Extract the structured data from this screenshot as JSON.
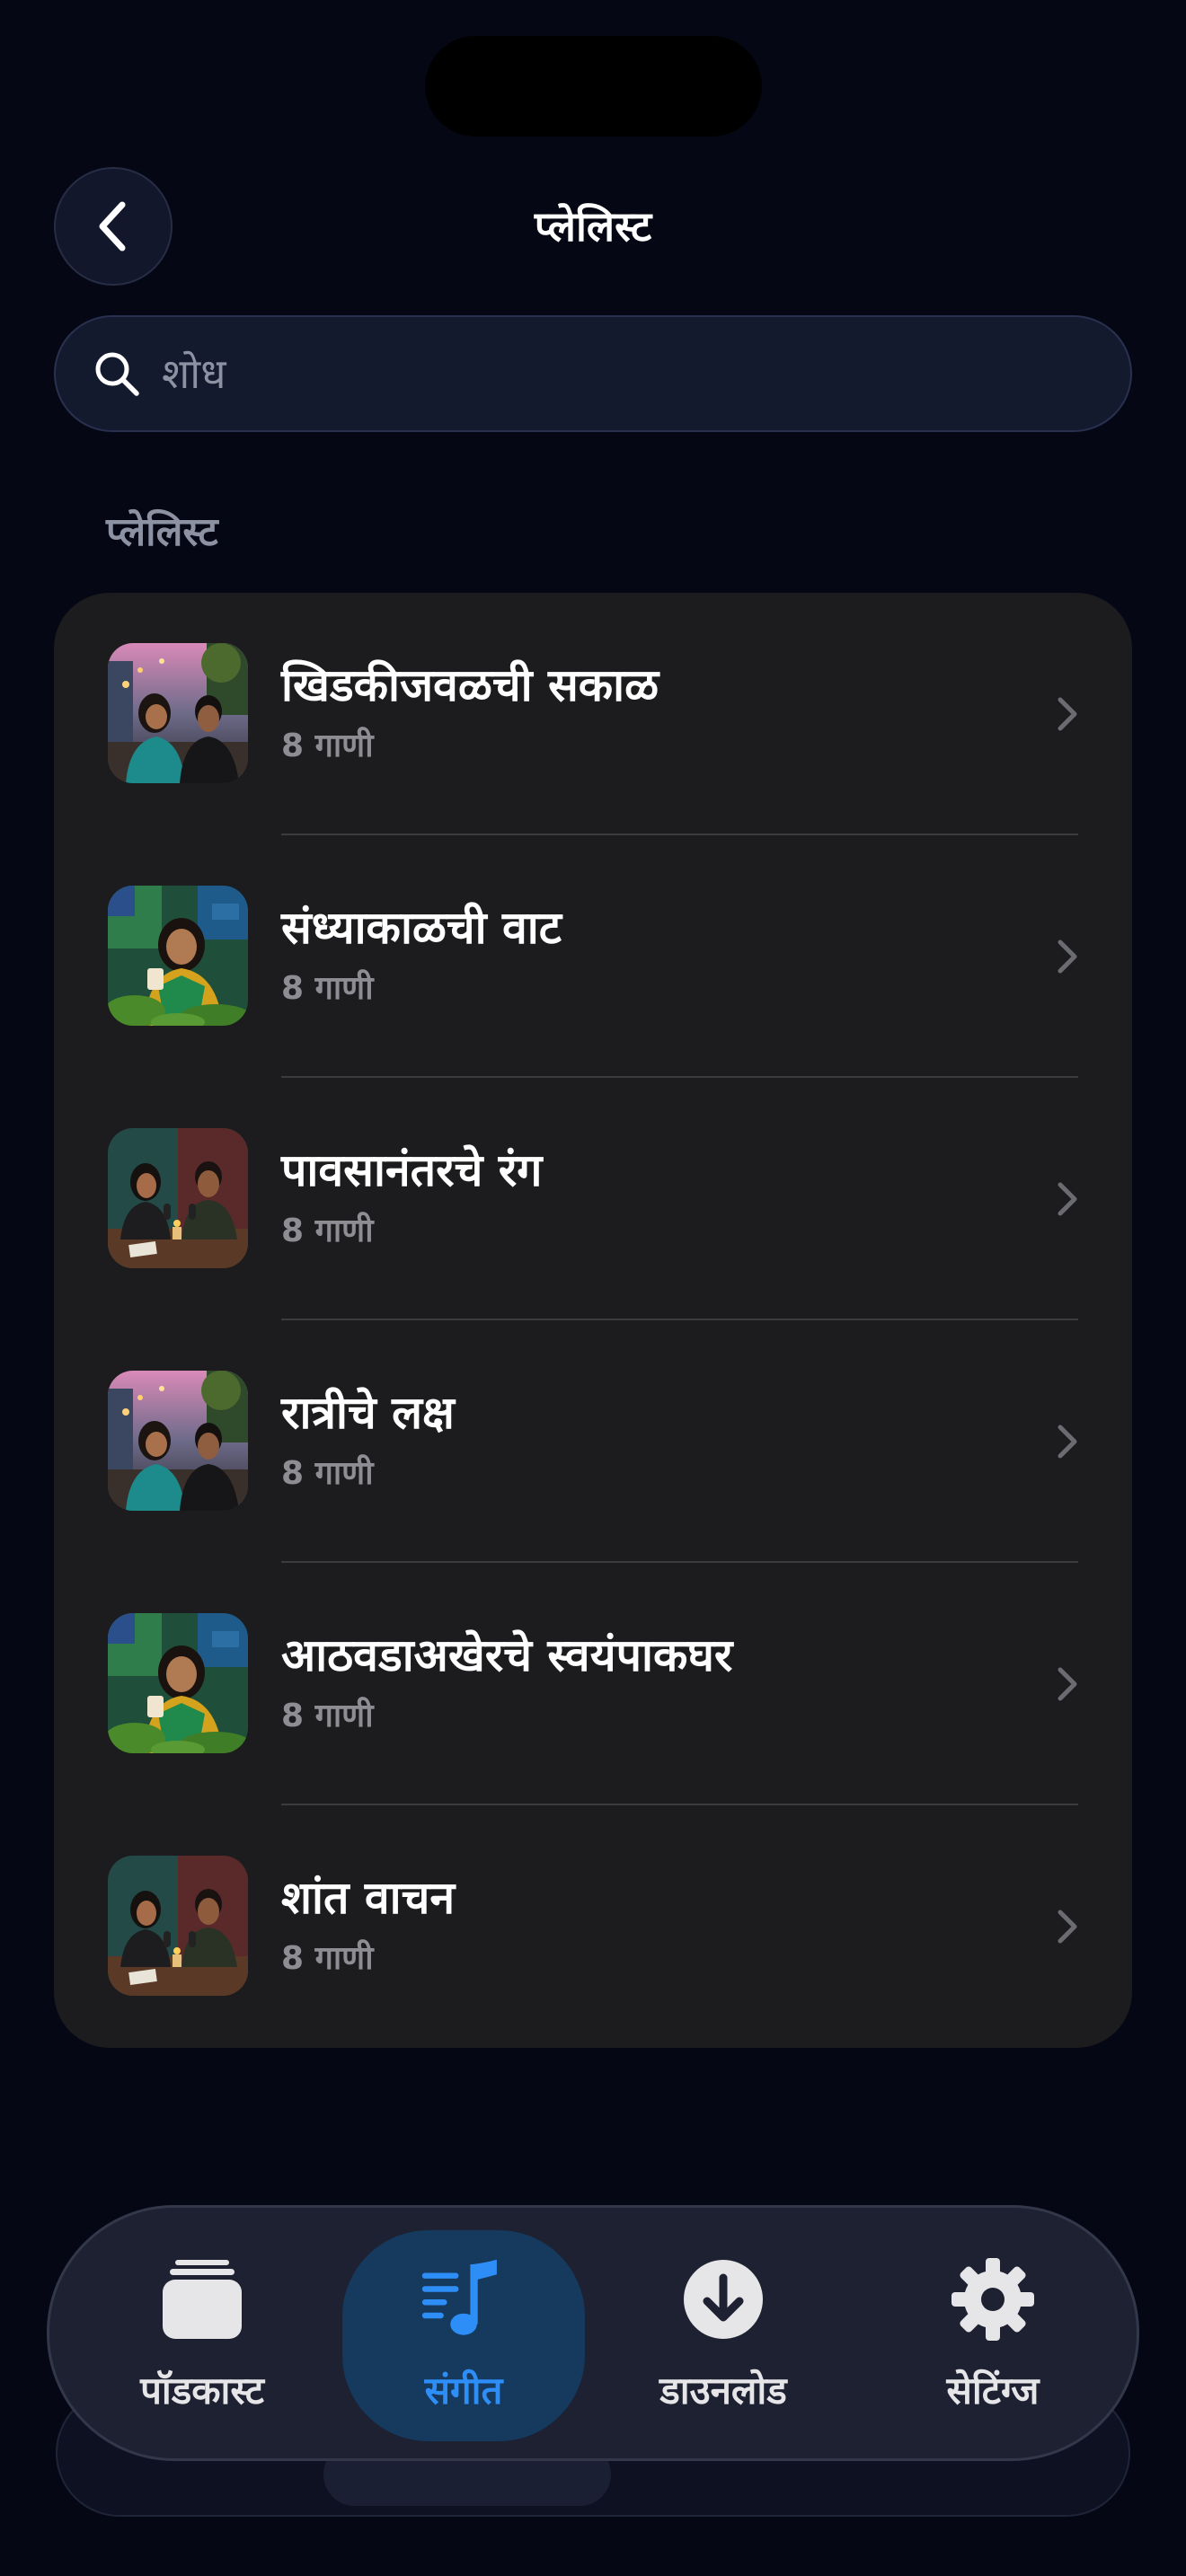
{
  "header": {
    "title": "प्लेलिस्ट"
  },
  "search": {
    "placeholder": "शोध",
    "value": ""
  },
  "section": {
    "label": "प्लेलिस्ट"
  },
  "playlists": [
    {
      "title": "खिडकीजवळची सकाळ",
      "count": "8 गाणी",
      "thumb": "street-couple"
    },
    {
      "title": "संध्याकाळची वाट",
      "count": "8 गाणी",
      "thumb": "woman-garden"
    },
    {
      "title": "पावसानंतरचे रंग",
      "count": "8 गाणी",
      "thumb": "studio-couple"
    },
    {
      "title": "रात्रीचे लक्ष",
      "count": "8 गाणी",
      "thumb": "street-couple"
    },
    {
      "title": "आठवडाअखेरचे स्वयंपाकघर",
      "count": "8 गाणी",
      "thumb": "woman-garden"
    },
    {
      "title": "शांत वाचन",
      "count": "8 गाणी",
      "thumb": "studio-couple"
    }
  ],
  "tabs": [
    {
      "label": "पॉडकास्ट",
      "icon": "podcast-stack-icon",
      "active": false
    },
    {
      "label": "संगीत",
      "icon": "music-list-icon",
      "active": true
    },
    {
      "label": "डाउनलोड",
      "icon": "download-icon",
      "active": false
    },
    {
      "label": "सेटिंग्ज",
      "icon": "gear-icon",
      "active": false
    }
  ],
  "colors": {
    "background": "#050814",
    "card": "#1c1c1e",
    "accent": "#2e8ef7",
    "secondary_text": "#8d8d93"
  }
}
